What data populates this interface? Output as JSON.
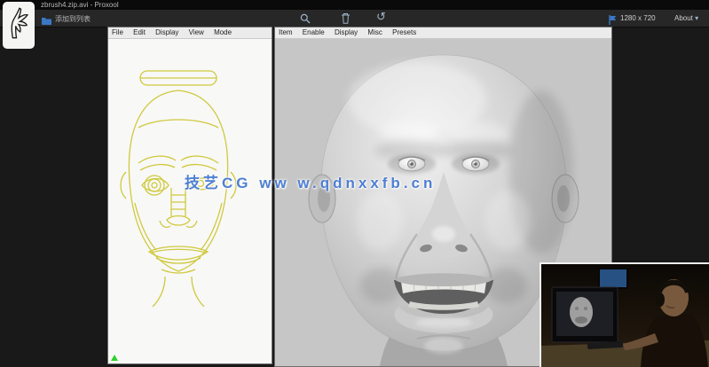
{
  "window": {
    "title": "zbrush4.zip.avi - Proxool"
  },
  "toolbar": {
    "file_label": "添加到列表",
    "resolution": "1280 x 720",
    "about_label": "About"
  },
  "left_panel": {
    "menu": [
      "File",
      "Edit",
      "Display",
      "View",
      "Mode"
    ]
  },
  "right_panel": {
    "menu": [
      "Item",
      "Enable",
      "Display",
      "Misc",
      "Presets"
    ]
  },
  "watermark": {
    "text": "技艺CG ww w.qdnxxfb.cn"
  },
  "colors": {
    "watermark_blue": "#4f7fd2",
    "curve_yellow": "#cfc93c",
    "accent_blue": "#3b78c4",
    "viewport_gray": "#c6c6c6",
    "marker_green": "#2ed22e"
  },
  "icons": {
    "logo": "hand-logo-icon",
    "toolbar": [
      "folder-icon",
      "magnifier-icon",
      "trash-icon",
      "undo-icon",
      "flag-icon",
      "chevron-down-icon"
    ]
  }
}
